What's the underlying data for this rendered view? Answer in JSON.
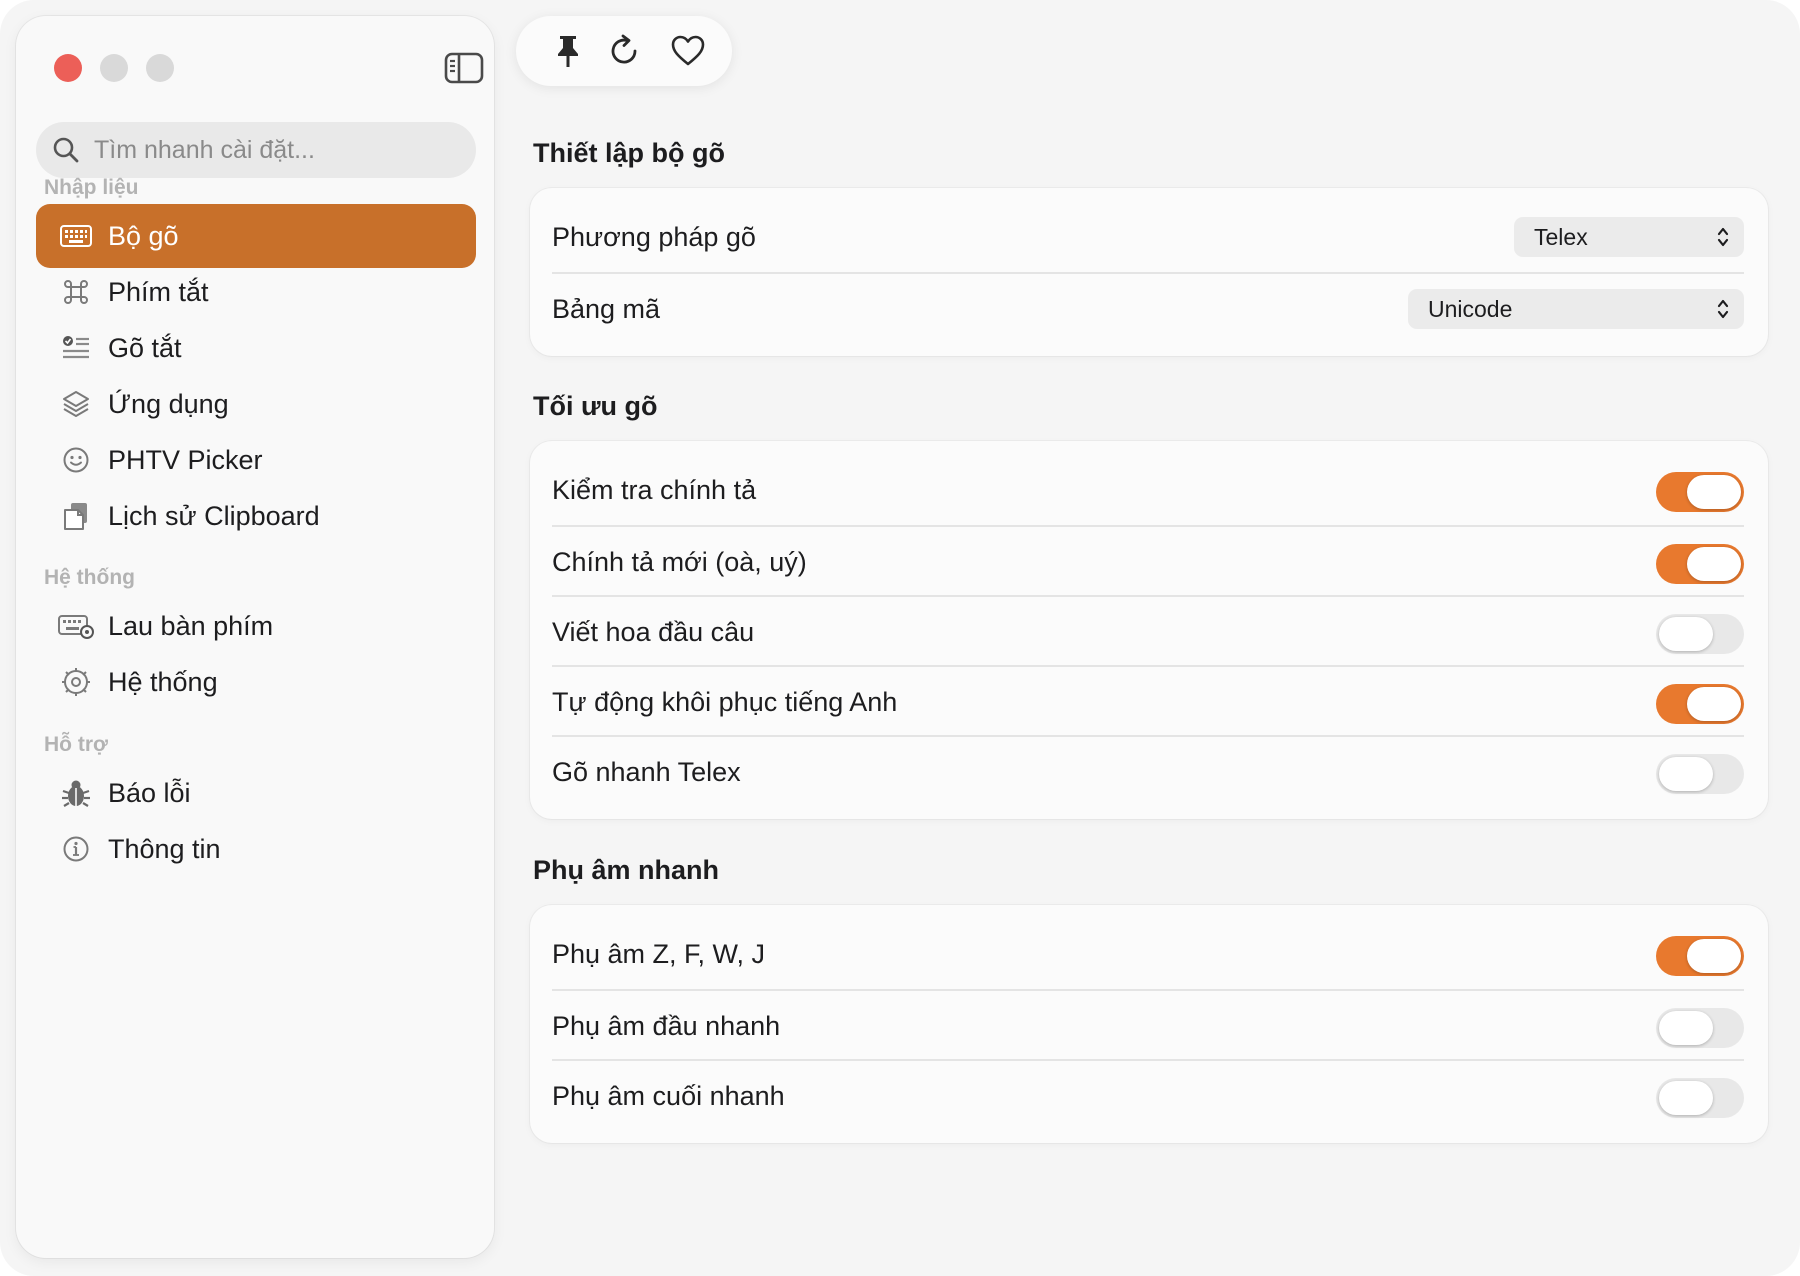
{
  "search": {
    "placeholder": "Tìm nhanh cài đặt..."
  },
  "sidebar": {
    "sections": [
      {
        "label": "Nhập liệu"
      },
      {
        "label": "Hệ thống"
      },
      {
        "label": "Hỗ trợ"
      }
    ],
    "items": [
      {
        "label": "Bộ gõ",
        "icon": "keyboard-icon",
        "active": true
      },
      {
        "label": "Phím tắt",
        "icon": "command-icon"
      },
      {
        "label": "Gõ tắt",
        "icon": "text-list-icon"
      },
      {
        "label": "Ứng dụng",
        "icon": "layers-icon"
      },
      {
        "label": "PHTV Picker",
        "icon": "smiley-icon"
      },
      {
        "label": "Lịch sử Clipboard",
        "icon": "clipboard-icon"
      },
      {
        "label": "Lau bàn phím",
        "icon": "keyboard-clean-icon"
      },
      {
        "label": "Hệ thống",
        "icon": "gear-icon"
      },
      {
        "label": "Báo lỗi",
        "icon": "bug-icon"
      },
      {
        "label": "Thông tin",
        "icon": "info-icon"
      }
    ]
  },
  "toolbar": {
    "icons": [
      "pin-icon",
      "refresh-icon",
      "heart-icon"
    ]
  },
  "groups": [
    {
      "title": "Thiết lập bộ gõ",
      "rows": [
        {
          "label": "Phương pháp gõ",
          "type": "select",
          "value": "Telex"
        },
        {
          "label": "Bảng mã",
          "type": "select",
          "value": "Unicode"
        }
      ]
    },
    {
      "title": "Tối ưu gõ",
      "rows": [
        {
          "label": "Kiểm tra chính tả",
          "type": "toggle",
          "on": true
        },
        {
          "label": "Chính tả mới (oà, uý)",
          "type": "toggle",
          "on": true
        },
        {
          "label": "Viết hoa đầu câu",
          "type": "toggle",
          "on": false
        },
        {
          "label": "Tự động khôi phục tiếng Anh",
          "type": "toggle",
          "on": true
        },
        {
          "label": "Gõ nhanh Telex",
          "type": "toggle",
          "on": false
        }
      ]
    },
    {
      "title": "Phụ âm nhanh",
      "rows": [
        {
          "label": "Phụ âm Z, F, W, J",
          "type": "toggle",
          "on": true
        },
        {
          "label": "Phụ âm đầu nhanh",
          "type": "toggle",
          "on": false
        },
        {
          "label": "Phụ âm cuối nhanh",
          "type": "toggle",
          "on": false
        }
      ]
    }
  ],
  "colors": {
    "accent": "#c8702a",
    "toggle_on": "#e8792e",
    "toggle_off": "#e8e8e8"
  }
}
